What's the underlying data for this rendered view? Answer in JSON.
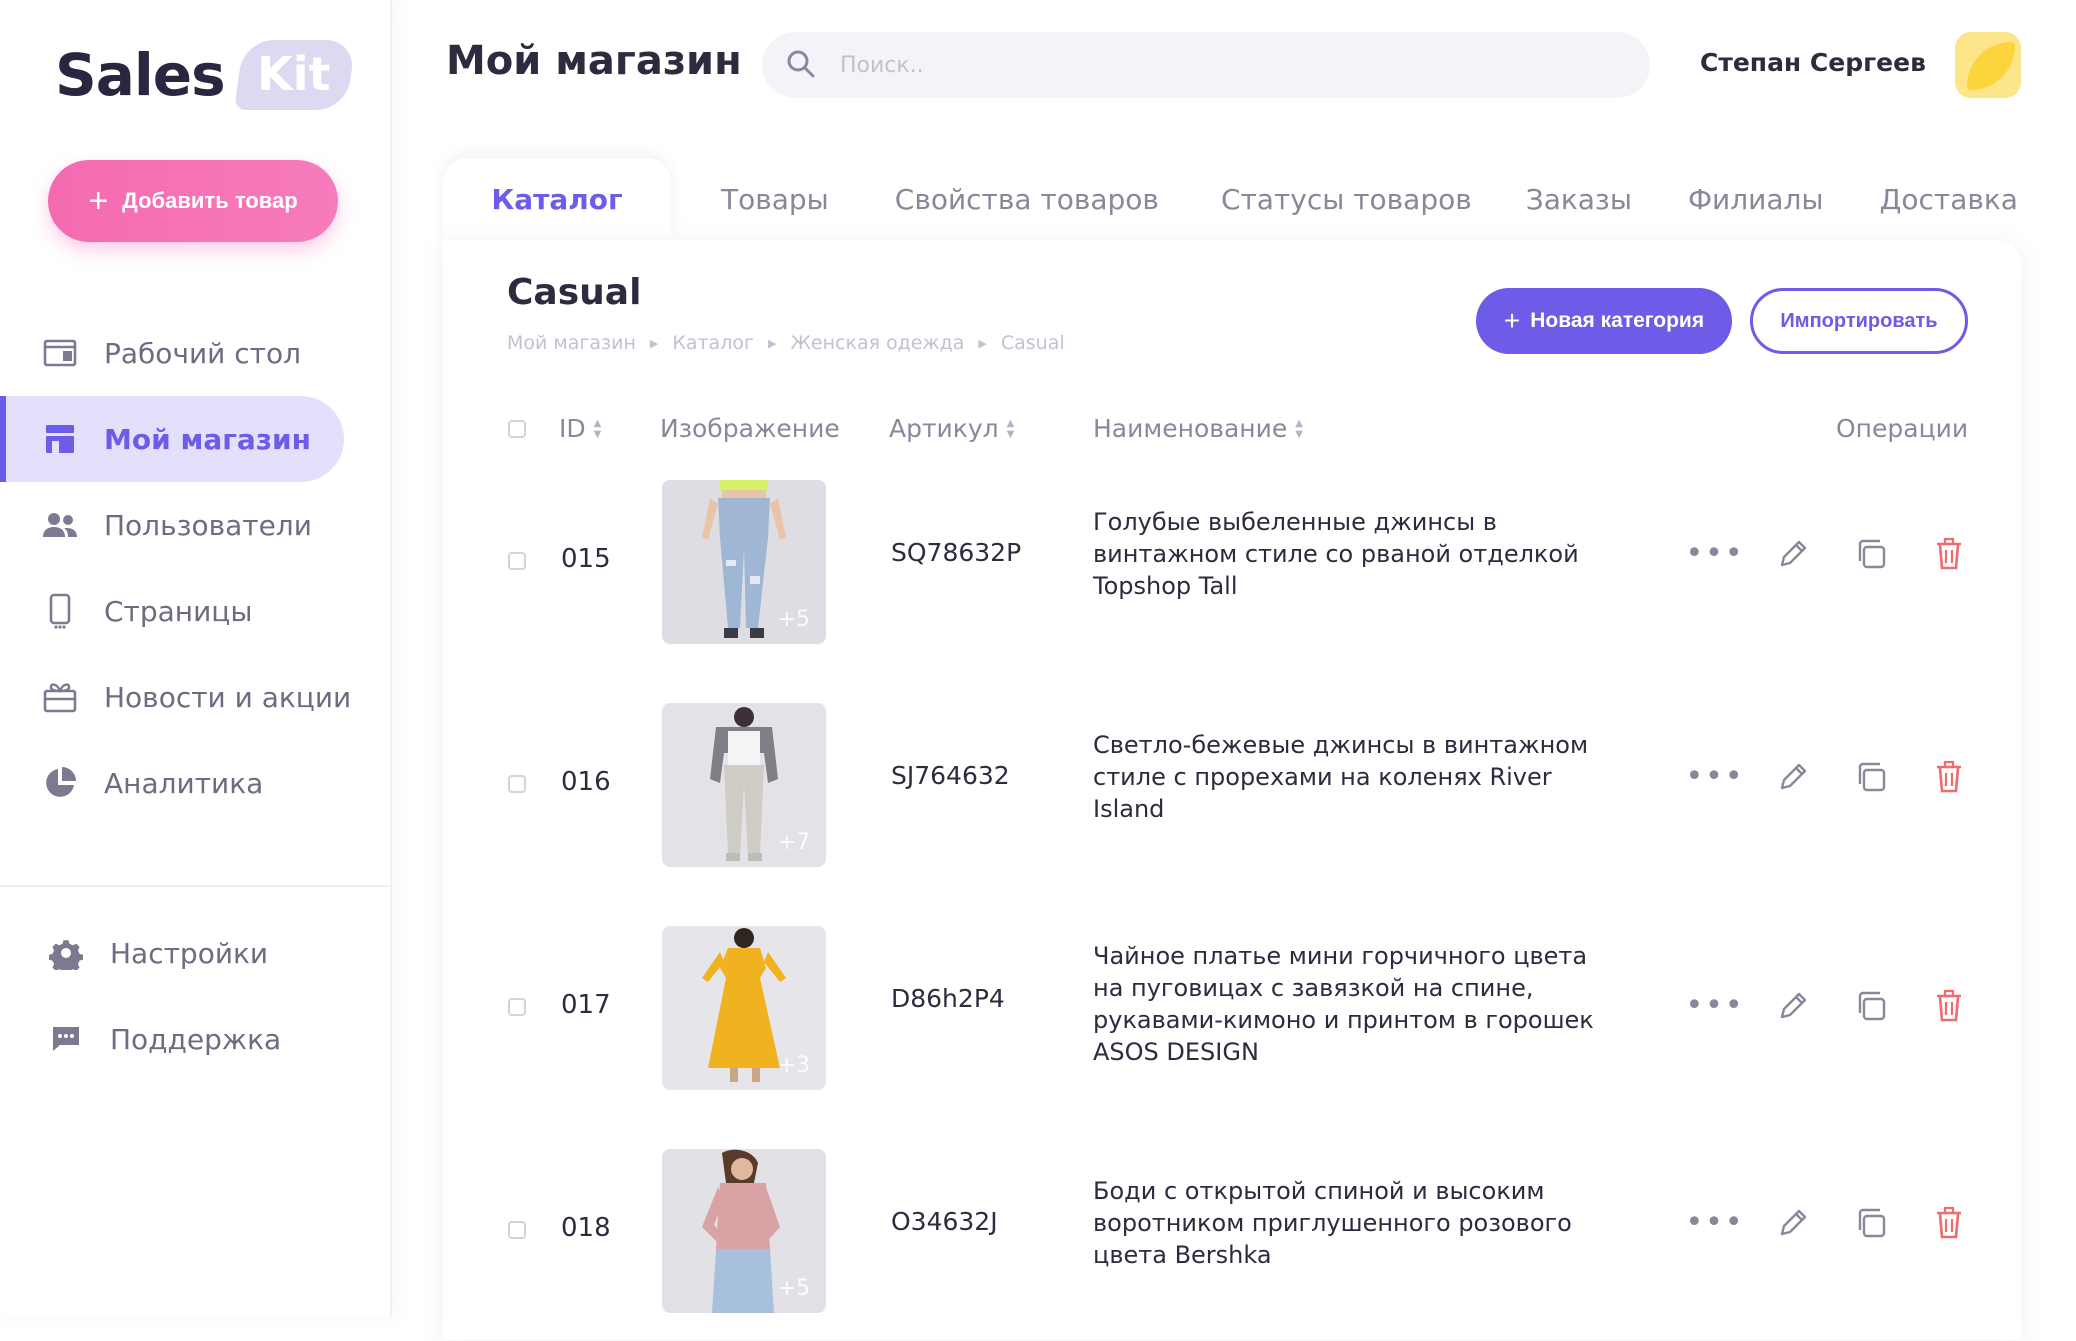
{
  "logo": {
    "word": "Sales",
    "badge": "Kit"
  },
  "add_button": "Добавить товар",
  "nav": [
    {
      "label": "Рабочий стол",
      "icon": "desktop-icon",
      "active": false
    },
    {
      "label": "Мой магазин",
      "icon": "store-icon",
      "active": true
    },
    {
      "label": "Пользователи",
      "icon": "users-icon",
      "active": false
    },
    {
      "label": "Страницы",
      "icon": "mobile-icon",
      "active": false
    },
    {
      "label": "Новости и акции",
      "icon": "gift-icon",
      "active": false
    },
    {
      "label": "Аналитика",
      "icon": "pie-chart-icon",
      "active": false
    }
  ],
  "nav_bottom": [
    {
      "label": "Настройки",
      "icon": "gear-icon"
    },
    {
      "label": "Поддержка",
      "icon": "chat-icon"
    }
  ],
  "header": {
    "title": "Мой магазин",
    "search_placeholder": "Поиск..",
    "user_name": "Степан Сергеев"
  },
  "tabs": [
    "Каталог",
    "Товары",
    "Свойства товаров",
    "Статусы товаров",
    "Заказы",
    "Филиалы",
    "Доставка"
  ],
  "active_tab": "Каталог",
  "category": {
    "title": "Casual",
    "breadcrumbs": [
      "Мой магазин",
      "Каталог",
      "Женская одежда",
      "Casual"
    ],
    "new_button": "Новая категория",
    "import_button": "Импортировать"
  },
  "table": {
    "columns": [
      "ID",
      "Изображение",
      "Артикул",
      "Наименование",
      "Операции"
    ],
    "rows": [
      {
        "id": "015",
        "more": "+5",
        "sku": "SQ78632P",
        "name": "Голубые выбеленные джинсы в винтажном стиле со рваной отделкой Topshop Tall"
      },
      {
        "id": "016",
        "more": "+7",
        "sku": "SJ764632",
        "name": "Светло-бежевые джинсы в винтажном стиле с прорехами на коленях River Island"
      },
      {
        "id": "017",
        "more": "+3",
        "sku": "D86h2P4",
        "name": "Чайное платье мини горчичного цвета на пуговицах с завязкой на спине, рукавами-кимоно и принтом в горошек ASOS DESIGN"
      },
      {
        "id": "018",
        "more": "+5",
        "sku": "O34632J",
        "name": "Боди с открытой спиной и высоким воротником приглушенного розового цвета Bershka"
      }
    ]
  },
  "colors": {
    "accent": "#6c5ce7",
    "pink": "#f472b6",
    "danger": "#f06b6b"
  }
}
